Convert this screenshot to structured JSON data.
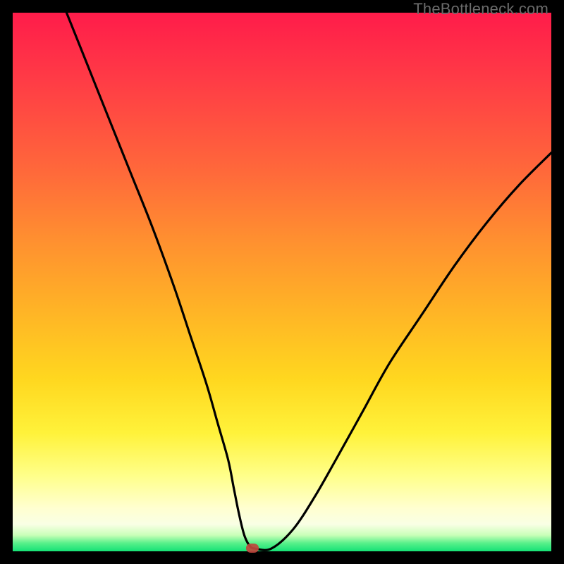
{
  "watermark": "TheBottleneck.com",
  "chart_data": {
    "type": "line",
    "title": "",
    "xlabel": "",
    "ylabel": "",
    "xlim": [
      0,
      100
    ],
    "ylim": [
      0,
      100
    ],
    "series": [
      {
        "name": "curve",
        "x": [
          10,
          14,
          18,
          22,
          26,
          30,
          33,
          36,
          38,
          40,
          41,
          42,
          43,
          44,
          45,
          48,
          52,
          56,
          60,
          65,
          70,
          76,
          82,
          88,
          94,
          100
        ],
        "y": [
          100,
          90,
          80,
          70,
          60,
          49,
          40,
          31,
          24,
          17,
          12,
          7,
          3,
          1,
          0.5,
          0.5,
          4,
          10,
          17,
          26,
          35,
          44,
          53,
          61,
          68,
          74
        ]
      }
    ],
    "marker": {
      "x": 44.5,
      "y": 0.5
    },
    "grid": false,
    "legend": false
  },
  "colors": {
    "curve": "#000000",
    "marker": "#c0453d",
    "frame": "#000000"
  }
}
